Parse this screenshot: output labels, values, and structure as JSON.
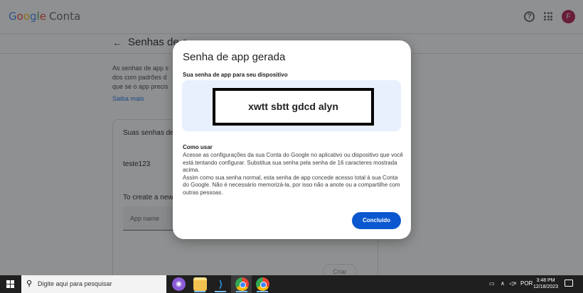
{
  "header": {
    "logo_brand": [
      "G",
      "o",
      "o",
      "g",
      "l",
      "e"
    ],
    "product": "Conta",
    "avatar_letter": "F"
  },
  "background": {
    "page_title": "Senhas de a",
    "intro_lines": [
      "As senhas de app s",
      "dos com padrões d",
      "que se o app precis"
    ],
    "learn_more": "Saiba mais",
    "card_title": "Suas senhas de",
    "app_entry": "teste123",
    "create_title": "To create a new",
    "app_name_placeholder": "App name",
    "create_button": "Criar"
  },
  "dialog": {
    "title": "Senha de app gerada",
    "subtitle": "Sua senha de app para seu dispositivo",
    "password": "xwtt sbtt gdcd alyn",
    "howto_title": "Como usar",
    "howto_p1": "Acesse as configurações da sua Conta do Google no aplicativo ou dispositivo que você está tentando configurar. Substitua sua senha pela senha de 16 caracteres mostrada acima.",
    "howto_p2": "Assim como sua senha normal, esta senha de app concede acesso total à sua Conta do Google. Não é necessário memorizá-la, por isso não a anote ou a compartilhe com outras pessoas.",
    "done_button": "Concluído"
  },
  "taskbar": {
    "search_placeholder": "Digite aqui para pesquisar",
    "language": "POR",
    "time": "3:48 PM",
    "date": "12/18/2023"
  }
}
